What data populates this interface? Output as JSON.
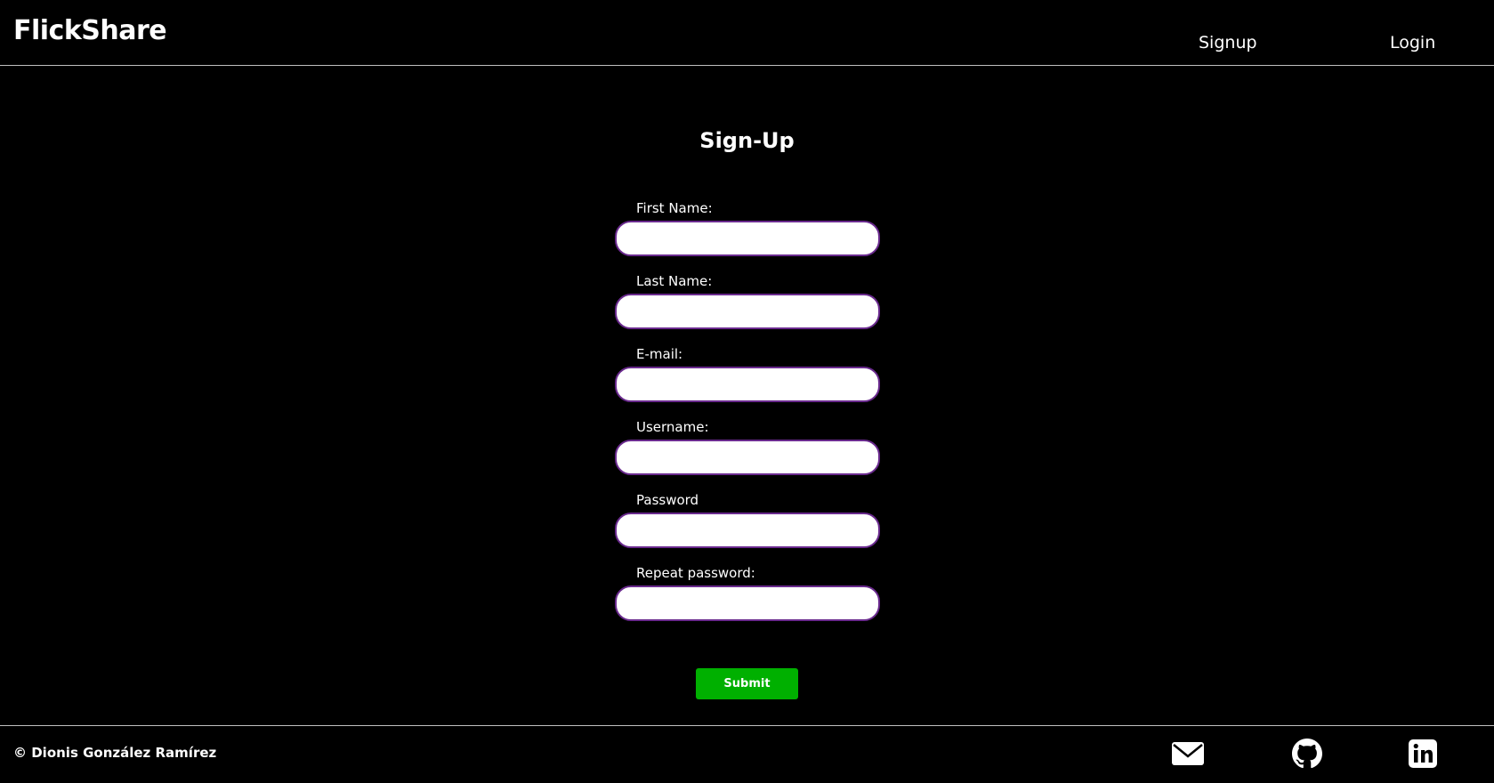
{
  "header": {
    "brand": "FlickShare",
    "nav": {
      "signup": "Signup",
      "login": "Login"
    }
  },
  "form": {
    "title": "Sign-Up",
    "fields": {
      "first_name": {
        "label": "First Name:",
        "value": ""
      },
      "last_name": {
        "label": "Last Name:",
        "value": ""
      },
      "email": {
        "label": "E-mail:",
        "value": ""
      },
      "username": {
        "label": "Username:",
        "value": ""
      },
      "password": {
        "label": "Password",
        "value": ""
      },
      "repeat_password": {
        "label": "Repeat password:",
        "value": ""
      }
    },
    "submit_label": "Submit"
  },
  "footer": {
    "copyright": "© Dionis González Ramírez",
    "social": [
      "mail-icon",
      "github-icon",
      "linkedin-icon"
    ]
  },
  "colors": {
    "background": "#000000",
    "submit": "#00b000",
    "input_border": "#6a2a8e",
    "divider": "#bfbfbf"
  }
}
